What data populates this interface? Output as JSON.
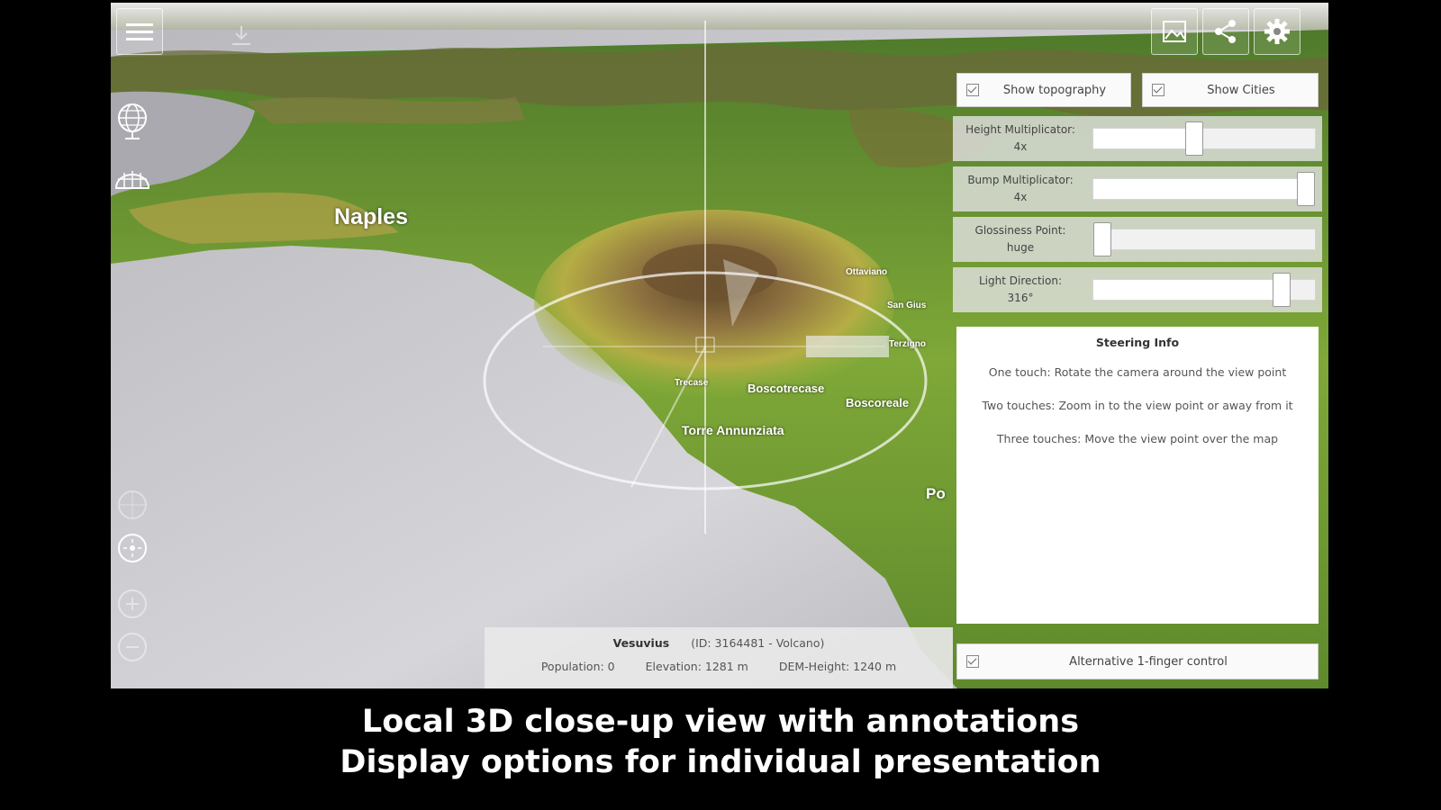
{
  "map": {
    "cities": {
      "naples": "Naples",
      "boscotrecase": "Boscotrecase",
      "boscoreale": "Boscoreale",
      "torre_annunziata": "Torre Annunziata",
      "terzigno": "Terzigno",
      "san_giuseppe": "San Gius",
      "ottaviano": "Ottaviano",
      "pompei_partial": "Po",
      "trecase": "Trecase"
    }
  },
  "toolbar": {
    "menu_icon": "hamburger-menu-icon",
    "download_icon": "download-icon",
    "image_icon": "image-icon",
    "share_icon": "share-icon",
    "settings_icon": "gear-icon"
  },
  "left_controls": {
    "globe_icon": "globe-icon",
    "grid_icon": "grid-globe-icon",
    "compass_icon": "compass-icon",
    "locate_icon": "locate-icon",
    "zoom_in_icon": "zoom-in-icon",
    "zoom_out_icon": "zoom-out-icon"
  },
  "settings": {
    "show_topography": "Show topography",
    "show_cities": "Show Cities",
    "height_multiplicator": "Height Multiplicator:",
    "height_value": "4x",
    "bump_multiplicator": "Bump Multiplicator:",
    "bump_value": "4x",
    "glossiness_point": "Glossiness Point:",
    "glossiness_value": "huge",
    "light_direction": "Light Direction:",
    "light_value": "316°",
    "height_level": 0.45,
    "bump_level": 1.0,
    "glossiness_level": 0.0,
    "light_level": 0.88
  },
  "steering": {
    "title": "Steering Info",
    "line1": "One touch: Rotate the camera around the view point",
    "line2": "Two touches: Zoom in to the view point or away from it",
    "line3": "Three touches: Move the view point over the map"
  },
  "alt_control": "Alternative 1-finger control",
  "status": {
    "name": "Vesuvius",
    "id": "(ID: 3164481",
    "type": "Volcano)",
    "population": "Population: 0",
    "elevation": "Elevation: 1281 m",
    "dem_height": "DEM-Height: 1240 m"
  },
  "caption": {
    "line1": "Local 3D close-up view with annotations",
    "line2": "Display options for individual presentation"
  },
  "colors": {
    "sea": "#c3c3c8",
    "land": "#6f9a2c",
    "mountain": "#8a6e38"
  }
}
